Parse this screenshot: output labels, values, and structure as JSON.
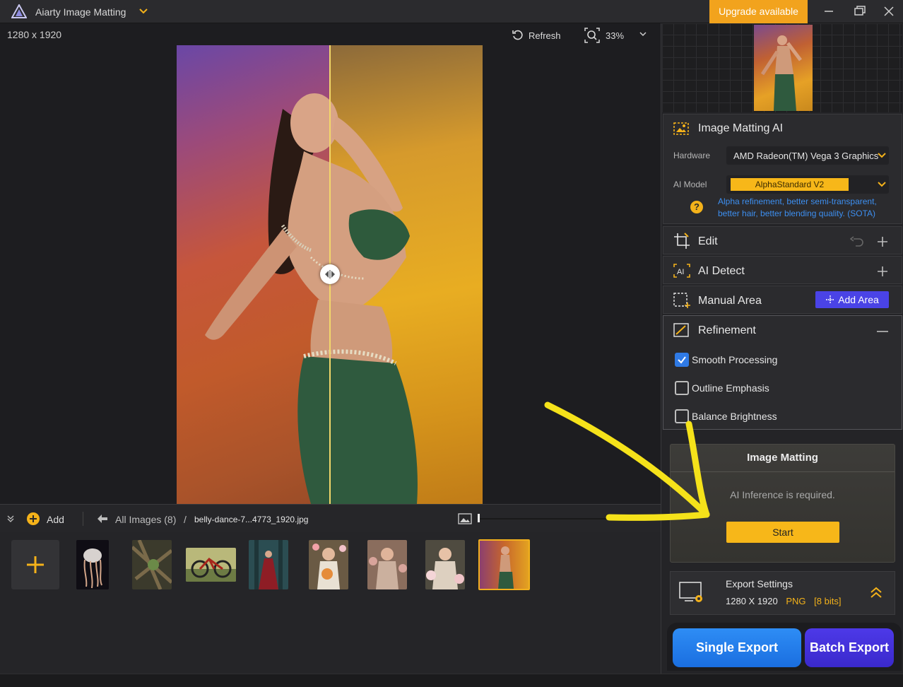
{
  "window": {
    "title": "Aiarty Image Matting",
    "upgrade_label": "Upgrade available"
  },
  "canvas": {
    "dimensions": "1280 x 1920",
    "refresh_label": "Refresh",
    "zoom": "33%"
  },
  "strip": {
    "add_label": "Add",
    "all_images": "All Images (8)",
    "separator": "/",
    "file_name": "belly-dance-7...4773_1920.jpg",
    "thumbnails": [
      {
        "name": "jellyfish",
        "color": "#1c1a22"
      },
      {
        "name": "forest-debris",
        "color": "#4c4a3a"
      },
      {
        "name": "bicycle",
        "color": "#8a8d5c"
      },
      {
        "name": "woman-red-dress-forest",
        "color": "#2f4f53"
      },
      {
        "name": "woman-flowers",
        "color": "#7a5a43"
      },
      {
        "name": "woman-floral",
        "color": "#8b6e5c"
      },
      {
        "name": "woman-roses",
        "color": "#6f6a5c"
      },
      {
        "name": "belly-dancer",
        "color": "#c4832a",
        "selected": true
      }
    ]
  },
  "panel": {
    "matting_ai": {
      "title": "Image Matting AI",
      "hardware_label": "Hardware",
      "hardware_value": "AMD Radeon(TM) Vega 3 Graphics",
      "model_label": "AI Model",
      "model_value": "AlphaStandard  V2",
      "model_description": "Alpha refinement, better semi-transparent, better hair, better blending quality. (SOTA)",
      "help_glyph": "?"
    },
    "edit_title": "Edit",
    "ai_detect_title": "AI Detect",
    "manual_area_title": "Manual Area",
    "add_area_label": "Add Area",
    "refinement": {
      "title": "Refinement",
      "options": [
        {
          "label": "Smooth Processing",
          "checked": true
        },
        {
          "label": "Outline Emphasis",
          "checked": false
        },
        {
          "label": "Balance Brightness",
          "checked": false
        }
      ]
    },
    "matting_card": {
      "title": "Image Matting",
      "message": "AI Inference is required.",
      "start_label": "Start"
    },
    "export": {
      "title": "Export Settings",
      "resolution": "1280 X 1920",
      "format": "PNG",
      "bits": "[8 bits]"
    },
    "single_export_label": "Single Export",
    "batch_export_label": "Batch Export"
  },
  "colors": {
    "accent_yellow": "#f7b719",
    "upgrade_orange": "#f2a31d",
    "add_area_blue": "#4a43e6",
    "single_export_blue": "#2e8df5",
    "batch_export_indigo": "#4d39e8",
    "checkbox_blue": "#2f7ae5",
    "annotation_arrow": "#f5e21a"
  },
  "icons": [
    "app-logo-icon",
    "chevron-down-icon",
    "minimize-icon",
    "maximize-icon",
    "close-icon",
    "refresh-icon",
    "zoom-icon",
    "split-handle-icon",
    "collapse-icon",
    "add-icon",
    "back-arrow-icon",
    "thumbnail-size-icon",
    "image-matting-icon",
    "edit-icon",
    "undo-icon",
    "plus-icon",
    "ai-detect-icon",
    "manual-area-icon",
    "refinement-icon",
    "minus-icon",
    "help-icon",
    "export-settings-icon",
    "expand-icon",
    "annotation-arrow-icon"
  ]
}
